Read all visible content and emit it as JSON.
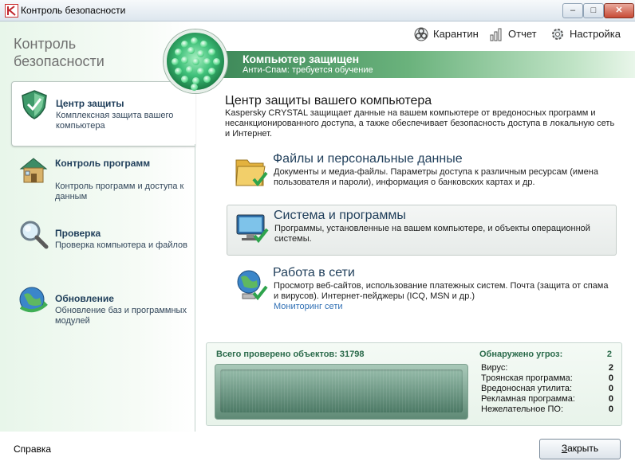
{
  "window": {
    "title": "Контроль безопасности",
    "min": "–",
    "max": "□",
    "close": "✕"
  },
  "brand": {
    "line1": "Контроль",
    "line2": "безопасности"
  },
  "toplinks": [
    {
      "label": "Карантин",
      "icon": "biohazard-icon"
    },
    {
      "label": "Отчет",
      "icon": "report-chart-icon"
    },
    {
      "label": "Настройка",
      "icon": "gear-icon"
    }
  ],
  "banner": {
    "title": "Компьютер защищен",
    "subtitle": "Анти-Спам: требуется обучение"
  },
  "nav": [
    {
      "title": "Центр защиты",
      "desc": "Комплексная защита вашего компьютера",
      "icon": "shield-icon"
    },
    {
      "title": "Контроль программ",
      "desc": "Контроль программ и доступа к данным",
      "icon": "house-icon"
    },
    {
      "title": "Проверка",
      "desc": "Проверка компьютера и файлов",
      "icon": "magnifier-icon"
    },
    {
      "title": "Обновление",
      "desc": "Обновление баз и программных модулей",
      "icon": "globe-update-icon"
    }
  ],
  "main": {
    "title": "Центр защиты вашего компьютера",
    "desc": "Kaspersky CRYSTAL защищает данные на вашем компьютере от вредоносных программ и несанкционированного доступа, а также обеспечивает безопасность доступа в локальную сеть и Интернет."
  },
  "sections": [
    {
      "title": "Файлы и персональные данные",
      "desc": "Документы и медиа-файлы. Параметры доступа к различным ресурсам (имена пользователя и пароли), информация о банковских картах и др.",
      "icon": "folder-icon"
    },
    {
      "title": "Система и программы",
      "desc": "Программы, установленные на вашем компьютере, и объекты операционной системы.",
      "icon": "monitor-icon"
    },
    {
      "title": "Работа в сети",
      "desc": "Просмотр веб-сайтов, использование платежных систем. Почта (защита от спама и вирусов). Интернет-пейджеры (ICQ, MSN и др.)",
      "link": "Мониторинг сети",
      "icon": "globe-network-icon"
    }
  ],
  "stats": {
    "total_label": "Всего проверено объектов: 31798",
    "threats_label": "Обнаружено угроз:",
    "threats_value": "2",
    "rows": [
      {
        "name": "Вирус:",
        "value": "2"
      },
      {
        "name": "Троянская программа:",
        "value": "0"
      },
      {
        "name": "Вредоносная утилита:",
        "value": "0"
      },
      {
        "name": "Рекламная программа:",
        "value": "0"
      },
      {
        "name": "Нежелательное ПО:",
        "value": "0"
      }
    ]
  },
  "footer": {
    "help": "Справка",
    "close_prefix": "З",
    "close_rest": "акрыть"
  }
}
